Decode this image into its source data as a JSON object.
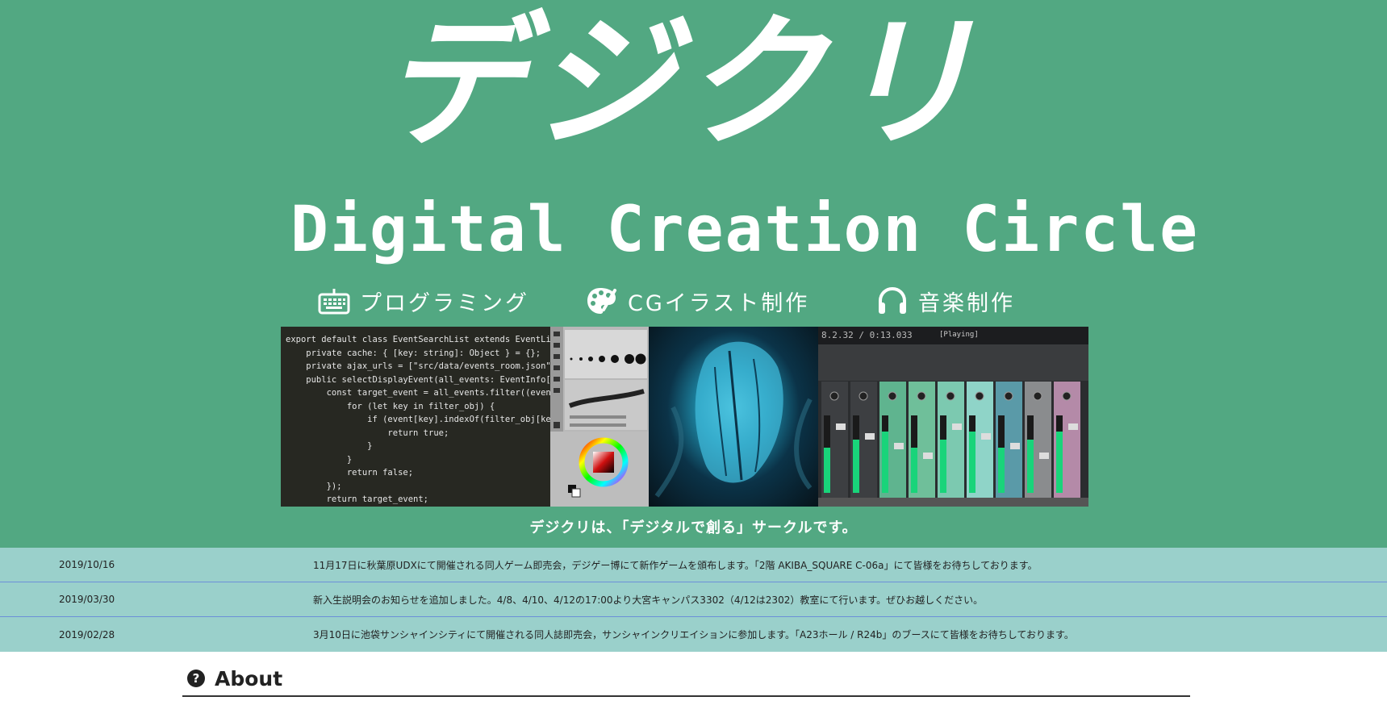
{
  "hero": {
    "logo_jp": "デジクリ",
    "logo_en": "Digital Creation Circle",
    "categories": [
      {
        "icon": "keyboard-icon",
        "label": "プログラミング"
      },
      {
        "icon": "palette-icon",
        "label": "CGイラスト制作"
      },
      {
        "icon": "headphones-icon",
        "label": "音楽制作"
      }
    ],
    "code_lines": [
      "export default class EventSearchList extends EventList {",
      "    private cache: { [key: string]: Object } = {};",
      "    private ajax_urls = [\"src/data/events_room.json\", \"src/d",
      "    public selectDisplayEvent(all_events: EventInfo[], filte",
      "        const target_event = all_events.filter((event) => {",
      "            for (let key in filter_obj) {",
      "                if (event[key].indexOf(filter_obj[key]) !==",
      "                    return true;",
      "                }",
      "            }",
      "            return false;",
      "        });",
      "        return target_event;",
      "    }"
    ],
    "mixer_header": "8.2.32 / 0:13.033",
    "mixer_status": "[Playing]",
    "tagline": "デジクリは、「デジタルで創る」サークルです。"
  },
  "news": [
    {
      "date": "2019/10/16",
      "text": "11月17日に秋葉原UDXにて開催される同人ゲーム即売会，デジゲー博にて新作ゲームを頒布します。「2階 AKIBA_SQUARE C-06a」にて皆様をお待ちしております。"
    },
    {
      "date": "2019/03/30",
      "text": "新入生説明会のお知らせを追加しました。4/8、4/10、4/12の17:00より大宮キャンパス3302（4/12は2302）教室にて行います。ぜひお越しください。"
    },
    {
      "date": "2019/02/28",
      "text": "3月10日に池袋サンシャインシティにて開催される同人誌即売会，サンシャインクリエイションに参加します。「A23ホール / R24b」のブースにて皆様をお待ちしております。"
    }
  ],
  "about": {
    "icon": "question-circle-icon",
    "title": "About"
  }
}
